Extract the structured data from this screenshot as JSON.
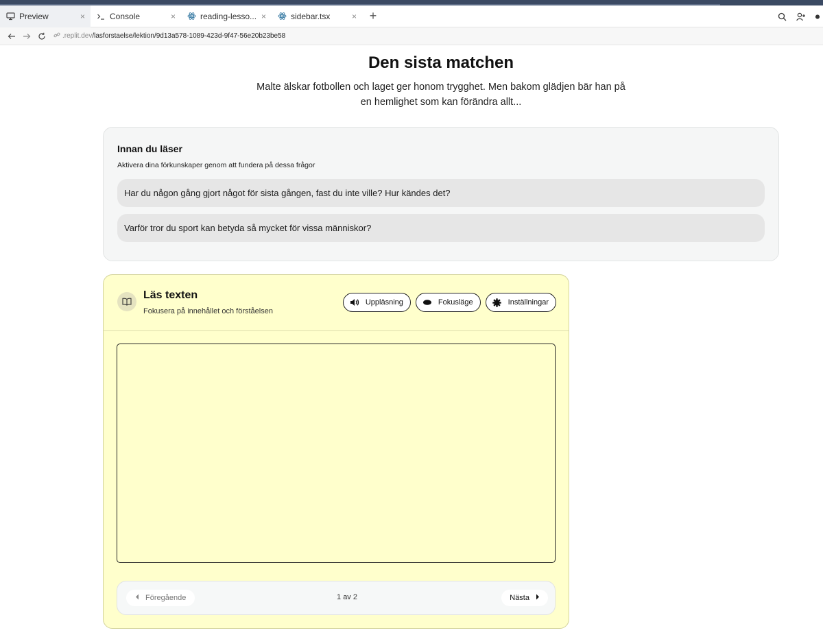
{
  "browser": {
    "tabs": [
      {
        "label": "Preview",
        "icon": "monitor-icon",
        "active": true
      },
      {
        "label": "Console",
        "icon": "terminal-icon",
        "active": false
      },
      {
        "label": "reading-lesso...",
        "icon": "react-icon",
        "active": false
      },
      {
        "label": "sidebar.tsx",
        "icon": "react-icon",
        "active": false
      }
    ],
    "new_tab": "+",
    "close_glyph": "×",
    "url_host": ".replit.dev",
    "url_path": "/lasforstaelse/lektion/9d13a578-1089-423d-9f47-56e20b23be58"
  },
  "lesson": {
    "title": "Den sista matchen",
    "lead": "Malte älskar fotbollen och laget ger honom trygghet. Men bakom glädjen bär han på en hemlighet som kan förändra allt..."
  },
  "before_reading": {
    "title": "Innan du läser",
    "subtitle": "Aktivera dina förkunskaper genom att fundera på dessa frågor",
    "questions": [
      "Har du någon gång gjort något för sista gången, fast du inte ville? Hur kändes det?",
      "Varför tror du sport kan betyda så mycket för vissa människor?"
    ]
  },
  "reader": {
    "title": "Läs texten",
    "subtitle": "Fokusera på innehållet och förståelsen",
    "buttons": {
      "read_aloud": "Uppläsning",
      "focus_mode": "Fokusläge",
      "settings": "Inställningar"
    },
    "pager": {
      "prev": "Föregående",
      "next": "Nästa",
      "count": "1 av 2"
    }
  },
  "colors": {
    "reader_bg": "#ffffcc",
    "card_bg": "#f5f6f6",
    "question_bg": "#e6e6e6"
  }
}
